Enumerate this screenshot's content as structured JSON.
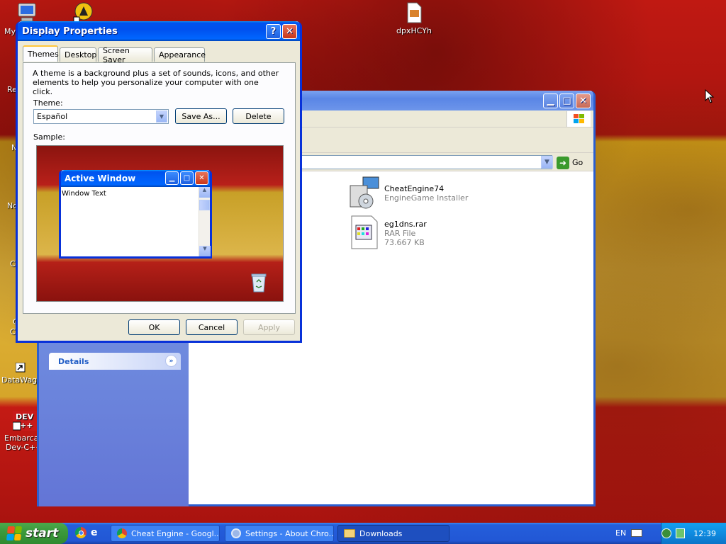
{
  "desktop": {
    "icons": [
      {
        "label": "My",
        "icon": "computer-icon"
      },
      {
        "label": "",
        "icon": "app-shortcut-icon"
      },
      {
        "label": "dpxHCYh",
        "icon": "file-icon"
      },
      {
        "label": "Re",
        "icon": "recycle-bin-icon"
      },
      {
        "label": "N",
        "icon": "network-icon"
      },
      {
        "label": "No",
        "icon": "notepad-icon"
      },
      {
        "label": "C",
        "icon": "app-icon"
      },
      {
        "label": "C",
        "icon": "app-icon"
      },
      {
        "label": "C",
        "icon": "app-icon"
      },
      {
        "label": "DataWago",
        "icon": "datawago-shortcut-icon"
      },
      {
        "label": "Embarcad\nDev-C++",
        "icon": "devcpp-icon"
      }
    ]
  },
  "explorer": {
    "go_label": "Go",
    "details_label": "Details",
    "files": [
      {
        "name": "CheatEngine74",
        "type": "EngineGame Installer",
        "size": ""
      },
      {
        "name": "eg1dns.rar",
        "type": "RAR File",
        "size": "73.667 KB"
      }
    ]
  },
  "dialog": {
    "title": "Display Properties",
    "help_btn": "?",
    "close_btn": "✕",
    "tabs": [
      "Themes",
      "Desktop",
      "Screen Saver",
      "Appearance"
    ],
    "description": "A theme is a background plus a set of sounds, icons, and other elements to help you personalize your computer with one click.",
    "theme_label": "Theme:",
    "theme_value": "Español",
    "save_as": "Save As...",
    "delete": "Delete",
    "sample_label": "Sample:",
    "sample_window_title": "Active Window",
    "sample_window_text": "Window Text",
    "ok": "OK",
    "cancel": "Cancel",
    "apply": "Apply"
  },
  "taskbar": {
    "start_label": "start",
    "buttons": [
      {
        "label": "Cheat Engine - Googl...",
        "icon": "chrome-icon"
      },
      {
        "label": "Settings - About Chro...",
        "icon": "settings-icon"
      },
      {
        "label": "Downloads",
        "icon": "folder-icon"
      }
    ],
    "language": "EN",
    "time": "12:39"
  },
  "colors": {
    "xp_blue": "#0054e3",
    "flag_red": "#c01912",
    "flag_yellow": "#e0b53a",
    "task_pane": "#6d7fd6"
  }
}
